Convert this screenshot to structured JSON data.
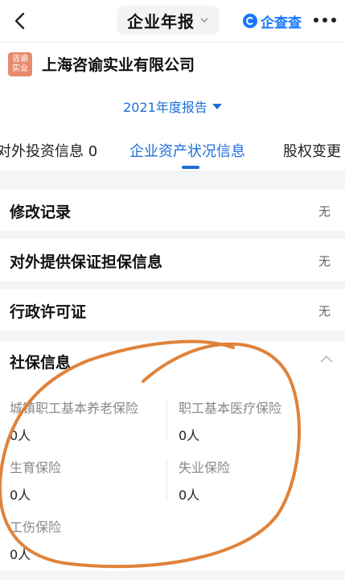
{
  "header": {
    "title": "企业年报",
    "brand": "企查查"
  },
  "company": {
    "logo_line1": "咨谕",
    "logo_line2": "实业",
    "name": "上海咨谕实业有限公司"
  },
  "report_selector": {
    "label": "2021年度报告"
  },
  "tabs": [
    {
      "label": "对外投资信息 0"
    },
    {
      "label": "企业资产状况信息"
    },
    {
      "label": "股权变更"
    }
  ],
  "rows": [
    {
      "label": "修改记录",
      "value": "无"
    },
    {
      "label": "对外提供保证担保信息",
      "value": "无"
    },
    {
      "label": "行政许可证",
      "value": "无"
    }
  ],
  "social_insurance": {
    "title": "社保信息",
    "fields": [
      {
        "label": "城镇职工基本养老保险",
        "value": "0人"
      },
      {
        "label": "职工基本医疗保险",
        "value": "0人"
      },
      {
        "label": "生育保险",
        "value": "0人"
      },
      {
        "label": "失业保险",
        "value": "0人"
      },
      {
        "label": "工伤保险",
        "value": "0人"
      }
    ]
  },
  "colors": {
    "accent": "#1d6fd8",
    "annotation": "#e0823a"
  }
}
